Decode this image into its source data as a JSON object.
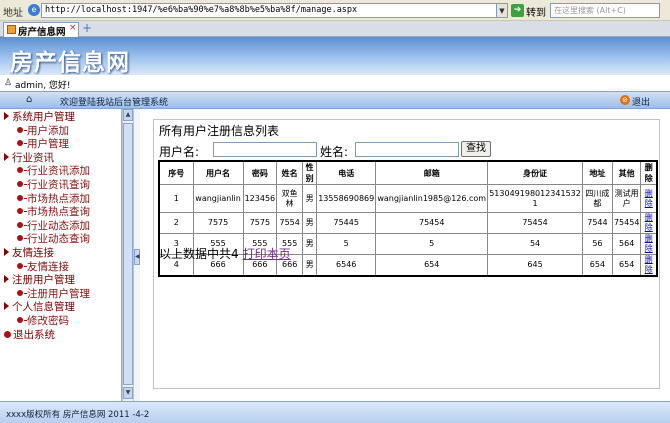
{
  "browser": {
    "address_label": "地址",
    "address_icon": "ie-page-icon",
    "url": "http://localhost:1947/%e6%ba%90%e7%a8%8b%e5%ba%8f/manage.aspx",
    "go_label": "转到",
    "search_placeholder": "在这里搜索 (Alt+C)",
    "tab_title": "房产信息网",
    "tab_close": "×",
    "tab_new": "+"
  },
  "header": {
    "site_title": "房产信息网"
  },
  "userbar": {
    "greeting": "admin, 您好!"
  },
  "navbar": {
    "welcome": "欢迎登陆我站后台管理系统",
    "logout": "退出"
  },
  "sidebar": {
    "items": [
      {
        "label": "系统用户管理",
        "level": "top"
      },
      {
        "label": "用户添加",
        "level": "sub"
      },
      {
        "label": "用户管理",
        "level": "sub"
      },
      {
        "label": "行业资讯",
        "level": "top"
      },
      {
        "label": "行业资讯添加",
        "level": "sub"
      },
      {
        "label": "行业资讯查询",
        "level": "sub"
      },
      {
        "label": "市场热点添加",
        "level": "sub"
      },
      {
        "label": "市场热点查询",
        "level": "sub"
      },
      {
        "label": "行业动态添加",
        "level": "sub"
      },
      {
        "label": "行业动态查询",
        "level": "sub"
      },
      {
        "label": "友情连接",
        "level": "top"
      },
      {
        "label": "友情连接",
        "level": "sub"
      },
      {
        "label": "注册用户管理",
        "level": "top"
      },
      {
        "label": "注册用户管理",
        "level": "sub"
      },
      {
        "label": "个人信息管理",
        "level": "top"
      },
      {
        "label": "修改密码",
        "level": "sub"
      },
      {
        "label": "退出系统",
        "level": "exit"
      }
    ]
  },
  "main": {
    "panel_title": "所有用户注册信息列表",
    "search": {
      "username_label": "用户名:",
      "name_label": "姓名:",
      "username_value": "",
      "name_value": "",
      "query_button": "查找"
    },
    "table": {
      "headers": [
        "序号",
        "用户名",
        "密码",
        "姓名",
        "性别",
        "电话",
        "邮箱",
        "身份证",
        "地址",
        "其他",
        "删除"
      ],
      "rows": [
        [
          "1",
          "wangjianlin",
          "123456",
          "双鱼林",
          "男",
          "13558690869",
          "wangjianlin1985@126.com",
          "513049198012341532​1",
          "四川成都",
          "测试用户",
          "删除"
        ],
        [
          "2",
          "7575",
          "7575",
          "7554",
          "男",
          "75445",
          "75454",
          "75454",
          "7544",
          "75454",
          "删除"
        ],
        [
          "3",
          "555",
          "555",
          "555",
          "男",
          "5",
          "5",
          "54",
          "56",
          "564",
          "删除"
        ],
        [
          "4",
          "666",
          "666",
          "666",
          "男",
          "6546",
          "654",
          "645",
          "654",
          "654",
          "删除"
        ]
      ]
    },
    "summary_prefix": "以上数据中共4",
    "print_link": "打印本页"
  },
  "footer": {
    "copyright": "xxxx版权所有  房产信息网  2011 -4-2"
  }
}
